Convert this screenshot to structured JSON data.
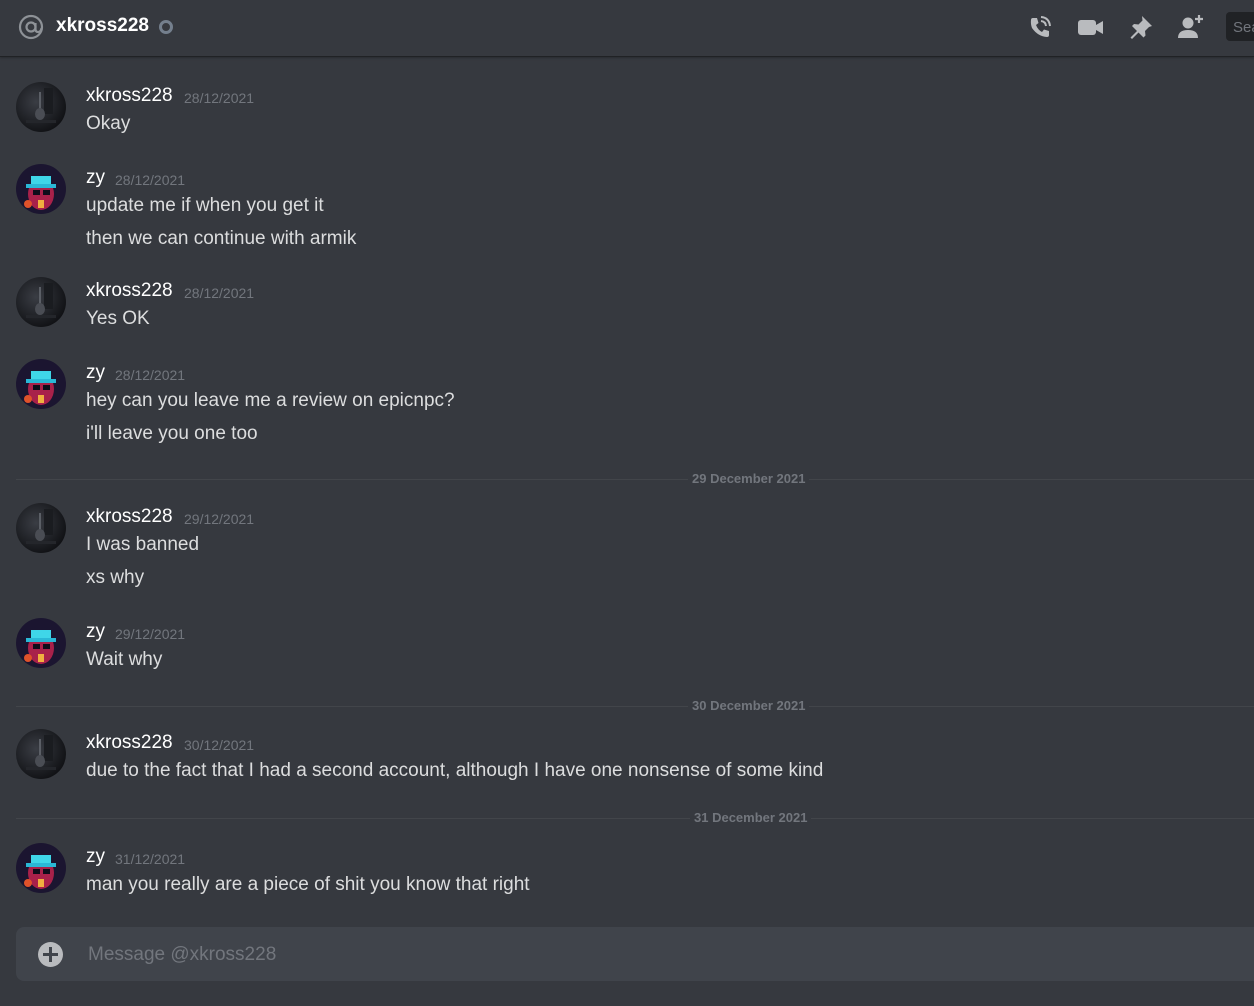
{
  "header": {
    "channel_name": "xkross228",
    "search_placeholder": "Search"
  },
  "icons": {
    "at": "at-sign-icon",
    "voice_call": "phone-call-icon",
    "video_call": "video-camera-icon",
    "pinned": "pin-icon",
    "add_friend": "add-user-icon",
    "upload": "plus-circle-icon"
  },
  "colors": {
    "background": "#36393f",
    "header_text": "#ffffff",
    "muted": "#72767d",
    "input_bg": "#40444b"
  },
  "messages": [
    {
      "author": "xkross228",
      "timestamp": "28/12/2021",
      "lines": [
        "Okay"
      ]
    },
    {
      "author": "zy",
      "timestamp": "28/12/2021",
      "lines": [
        "update me if when you get it",
        "then we can continue with armik"
      ]
    },
    {
      "author": "xkross228",
      "timestamp": "28/12/2021",
      "lines": [
        "Yes OK"
      ]
    },
    {
      "author": "zy",
      "timestamp": "28/12/2021",
      "lines": [
        "hey can you leave me a review on epicnpc?",
        "i'll leave you one too"
      ]
    },
    {
      "author": "xkross228",
      "timestamp": "29/12/2021",
      "lines": [
        "I was banned",
        "xs why"
      ]
    },
    {
      "author": "zy",
      "timestamp": "29/12/2021",
      "lines": [
        "Wait why"
      ]
    },
    {
      "author": "xkross228",
      "timestamp": "30/12/2021",
      "lines": [
        "due to the fact that I had a second account, although I have one nonsense of some kind"
      ]
    },
    {
      "author": "zy",
      "timestamp": "31/12/2021",
      "lines": [
        "man you really are a piece of shit you know that right"
      ]
    }
  ],
  "dividers": [
    "29 December 2021",
    "30 December 2021",
    "31 December 2021"
  ],
  "composer": {
    "placeholder": "Message @xkross228"
  }
}
